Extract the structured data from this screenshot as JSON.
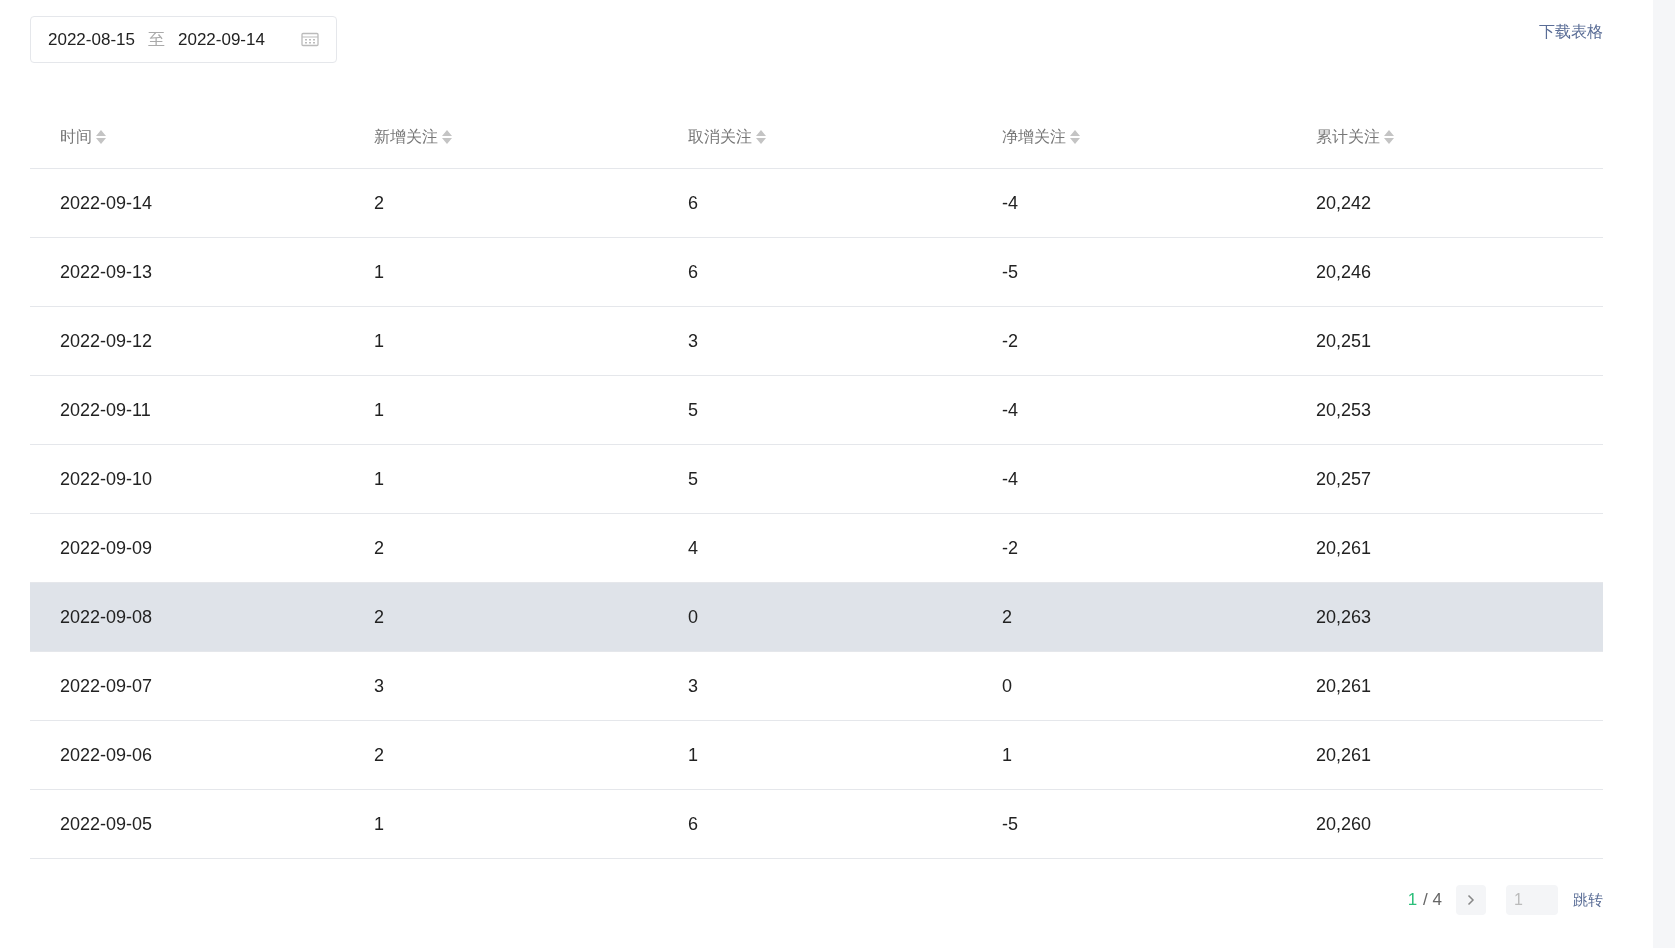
{
  "date_range": {
    "start": "2022-08-15",
    "separator": "至",
    "end": "2022-09-14"
  },
  "download_link": "下载表格",
  "table": {
    "columns": [
      "时间",
      "新增关注",
      "取消关注",
      "净增关注",
      "累计关注"
    ],
    "rows": [
      {
        "cells": [
          "2022-09-14",
          "2",
          "6",
          "-4",
          "20,242"
        ],
        "selected": false
      },
      {
        "cells": [
          "2022-09-13",
          "1",
          "6",
          "-5",
          "20,246"
        ],
        "selected": false
      },
      {
        "cells": [
          "2022-09-12",
          "1",
          "3",
          "-2",
          "20,251"
        ],
        "selected": false
      },
      {
        "cells": [
          "2022-09-11",
          "1",
          "5",
          "-4",
          "20,253"
        ],
        "selected": false
      },
      {
        "cells": [
          "2022-09-10",
          "1",
          "5",
          "-4",
          "20,257"
        ],
        "selected": false
      },
      {
        "cells": [
          "2022-09-09",
          "2",
          "4",
          "-2",
          "20,261"
        ],
        "selected": false
      },
      {
        "cells": [
          "2022-09-08",
          "2",
          "0",
          "2",
          "20,263"
        ],
        "selected": true
      },
      {
        "cells": [
          "2022-09-07",
          "3",
          "3",
          "0",
          "20,261"
        ],
        "selected": false
      },
      {
        "cells": [
          "2022-09-06",
          "2",
          "1",
          "1",
          "20,261"
        ],
        "selected": false
      },
      {
        "cells": [
          "2022-09-05",
          "1",
          "6",
          "-5",
          "20,260"
        ],
        "selected": false
      }
    ]
  },
  "pagination": {
    "current": "1",
    "total": "/ 4",
    "page_input": "1",
    "jump": "跳转"
  }
}
